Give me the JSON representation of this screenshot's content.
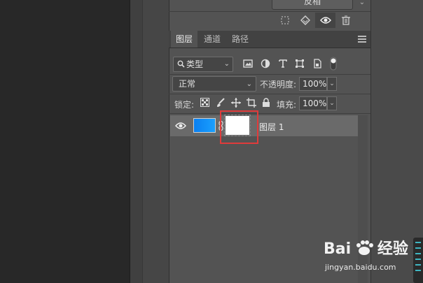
{
  "top": {
    "button_label": "反相"
  },
  "tabs": [
    {
      "label": "图层"
    },
    {
      "label": "通道"
    },
    {
      "label": "路径"
    }
  ],
  "filter": {
    "kind_label": "类型"
  },
  "blend": {
    "mode": "正常",
    "opacity_label": "不透明度:",
    "opacity_value": "100%"
  },
  "lock": {
    "label": "锁定:",
    "fill_label": "填充:",
    "fill_value": "100%"
  },
  "layer": {
    "name": "图层 1",
    "thumb_color": "#1a90ff"
  },
  "watermark": {
    "brand": "Bai",
    "brand2": "经验",
    "url": "jingyan.baidu.com"
  },
  "colors": {
    "highlight": "#e03b3b",
    "panel": "#535353"
  }
}
